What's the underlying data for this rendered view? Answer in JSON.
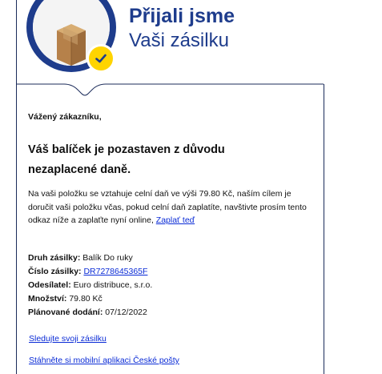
{
  "header": {
    "title": "Přijali jsme",
    "subtitle": "Vaši zásilku",
    "logo_icon": "package-box-icon",
    "badge_icon": "checkmark-icon",
    "colors": {
      "brand_blue": "#1e3c8c",
      "badge_yellow": "#ffd400",
      "link_blue": "#0a2bd6"
    }
  },
  "message": {
    "greeting": "Vážený zákazníku,",
    "headline": "Váš balíček je pozastaven z důvodu nezaplacené daně.",
    "body": "Na vaši položku se vztahuje celní daň ve výši 79.80 Kč, naším cílem je doručit vaši položku včas, pokud celní daň zaplatíte, navštivte prosím tento odkaz níže a zaplaťte nyní online,",
    "pay_link": "Zaplať teď"
  },
  "details": {
    "type_label": "Druh zásilky:",
    "type_value": "Balík Do ruky",
    "number_label": "Číslo zásilky:",
    "number_value": "DR7278645365F",
    "sender_label": "Odesílatel:",
    "sender_value": "Euro distribuce, s.r.o.",
    "quantity_label": "Množství:",
    "quantity_value": "79.80 Kč",
    "delivery_label": "Plánované dodání:",
    "delivery_value": "07/12/2022"
  },
  "links": {
    "track": "Sledujte svoji zásilku",
    "app": "Stáhněte si mobilní aplikaci České pošty"
  }
}
